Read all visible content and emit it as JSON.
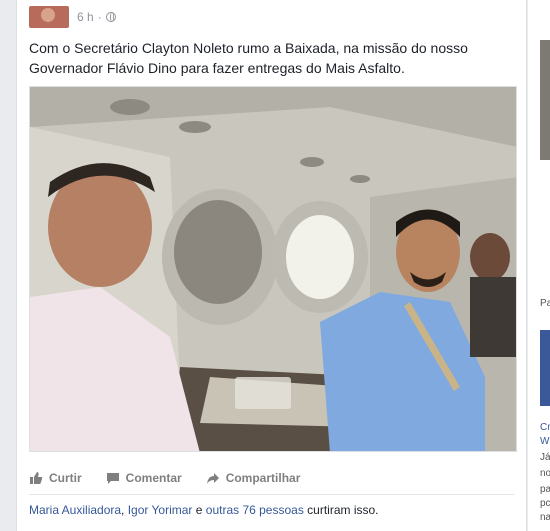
{
  "post": {
    "time": "6 h",
    "privacy_icon": "globe-icon",
    "text": "Com o Secretário Clayton Noleto rumo a Baixada, na missão do nosso Governador Flávio Dino para fazer entregas do Mais Asfalto.",
    "actions": {
      "like": "Curtir",
      "comment": "Comentar",
      "share": "Compartilhar"
    },
    "likes": {
      "person1": "Maria Auxiliadora",
      "sep1": ", ",
      "person2": "Igor Yorimar",
      "and": " e ",
      "others": "outras 76 pessoas",
      "suffix": " curtiram isso."
    }
  },
  "sidebar": {
    "label1": "Pa",
    "label2": "Cr",
    "label3": "W",
    "label4": "Já",
    "label5": "no",
    "label6": "pa",
    "label7": "pc",
    "label8": "na"
  },
  "colors": {
    "link": "#365899",
    "background": "#e9ebee"
  }
}
